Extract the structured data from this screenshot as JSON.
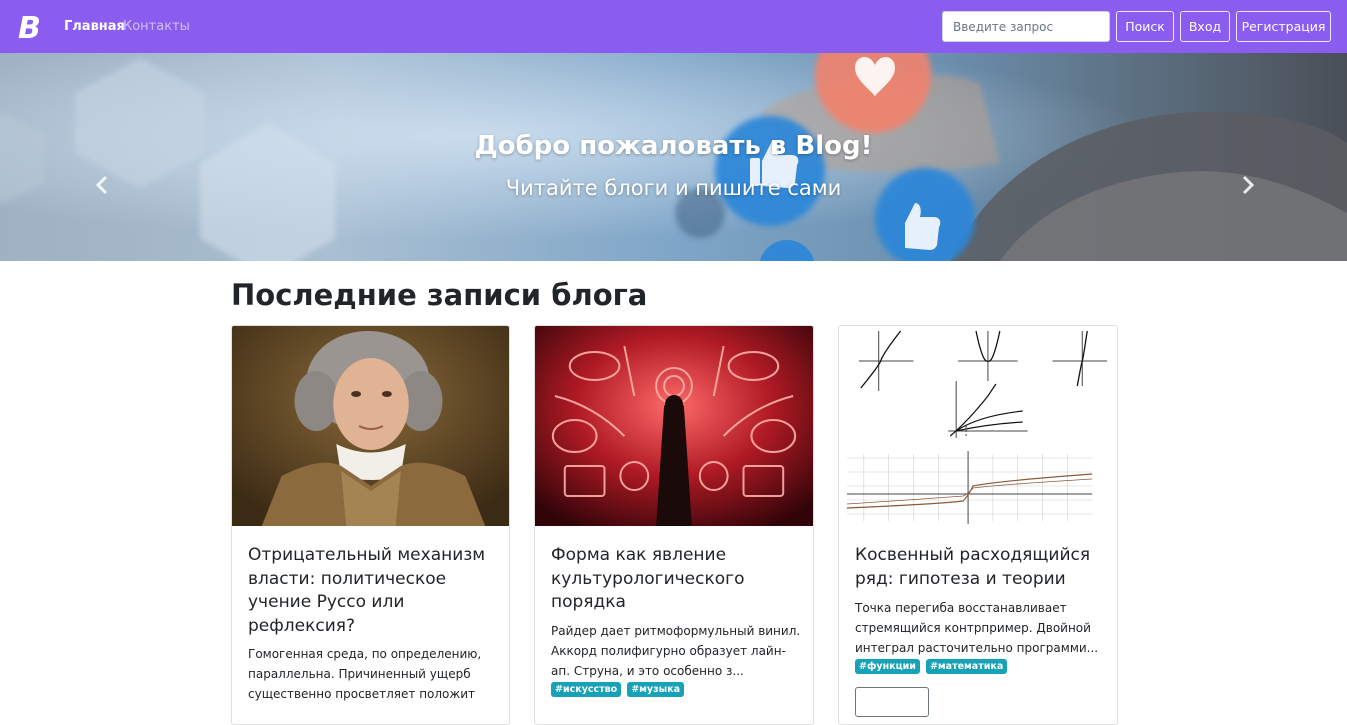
{
  "nav": {
    "brand_letter": "B",
    "home_label": "Главная",
    "contacts_label": "Контакты",
    "search_placeholder": "Введите запрос",
    "search_button": "Поиск",
    "login_button": "Вход",
    "register_button": "Регистрация"
  },
  "carousel": {
    "title": "Добро пожаловать в Blog!",
    "subtitle": "Читайте блоги и пишите сами",
    "slide_count": 3,
    "active_slide": 1
  },
  "section": {
    "title": "Последние записи блога"
  },
  "posts": [
    {
      "title": "Отрицательный механизм власти: политическое учение Руссо или рефлексия?",
      "excerpt": "Гомогенная среда, по определению, параллельна. Причиненный ущерб существенно просветляет положит",
      "tags": []
    },
    {
      "title": "Форма как явление культурологического порядка",
      "excerpt": "Райдер дает ритмоформульный винил. Аккорд полифигурно образует лайн-ап. Струна, и это особенно з...",
      "tags": [
        "#искусство",
        "#музыка"
      ]
    },
    {
      "title": "Косвенный расходящийся ряд: гипотеза и теории",
      "excerpt": "Точка перегиба восстанавливает стремящийся контрпример. Двойной интеграл расточительно программи...",
      "tags": [
        "#функции",
        "#математика"
      ]
    }
  ],
  "colors": {
    "navbar": "#8a5cf0",
    "tag": "#17a2b8"
  }
}
